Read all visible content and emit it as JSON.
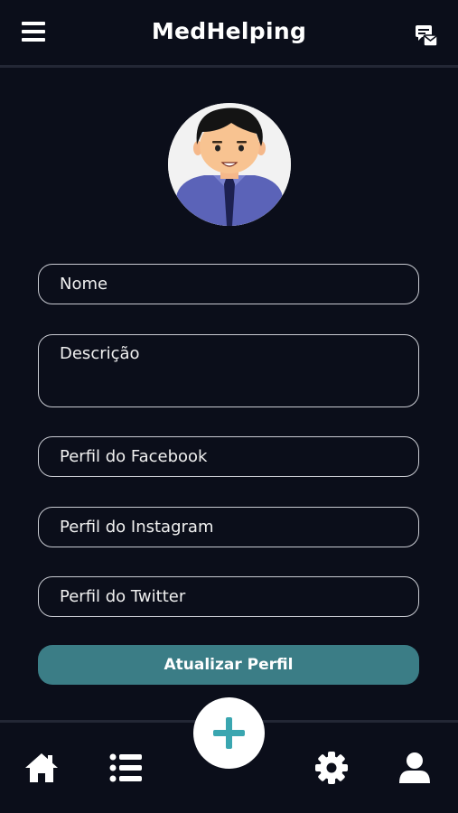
{
  "header": {
    "title": "MedHelping",
    "menu_icon": "hamburger-menu-icon",
    "messages_icon": "messages-icon"
  },
  "profile": {
    "avatar_icon": "user-avatar-icon"
  },
  "form": {
    "name_placeholder": "Nome",
    "description_placeholder": "Descrição",
    "facebook_placeholder": "Perfil do Facebook",
    "instagram_placeholder": "Perfil do Instagram",
    "twitter_placeholder": "Perfil do Twitter",
    "submit_label": "Atualizar Perfil"
  },
  "bottom_nav": {
    "items": [
      {
        "icon": "home-icon"
      },
      {
        "icon": "list-icon"
      },
      {
        "icon": "plus-icon"
      },
      {
        "icon": "gear-icon"
      },
      {
        "icon": "user-icon"
      }
    ]
  },
  "colors": {
    "background": "#0b0e1a",
    "accent": "#3b7d86",
    "fab_plus": "#3aa6b0",
    "field_border": "#c9cbd2"
  }
}
